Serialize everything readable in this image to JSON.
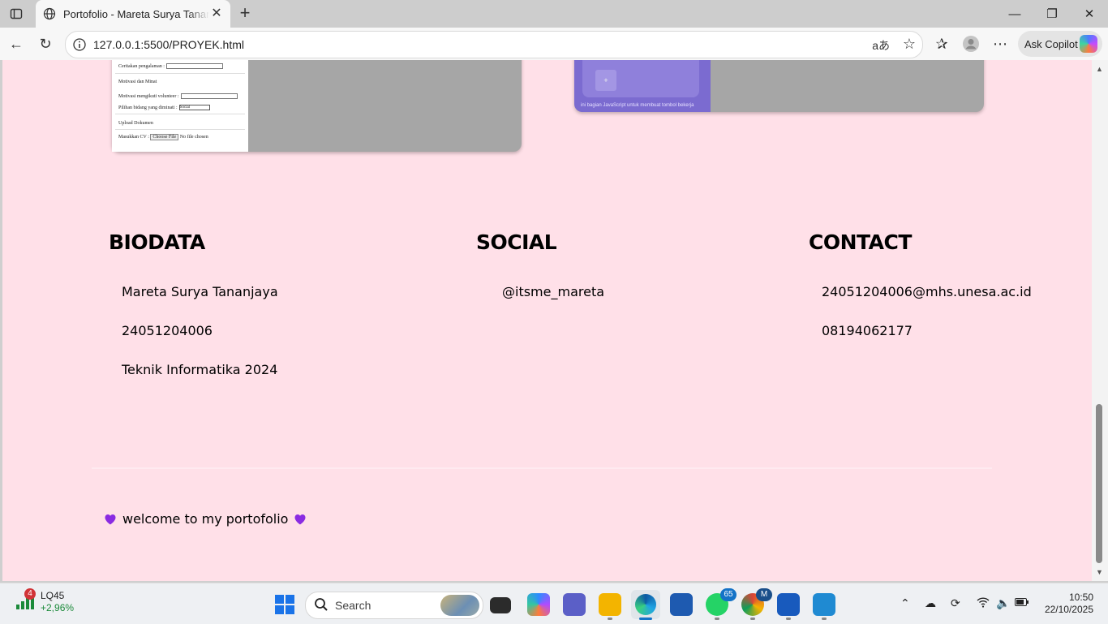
{
  "browser": {
    "tab_title": "Portofolio - Mareta Surya Tananja",
    "new_tab": "+",
    "url": "127.0.0.1:5500/PROYEK.html",
    "copilot_label": "Ask Copilot",
    "read_aloud_glyph": "aあ"
  },
  "page": {
    "project1_form": {
      "row1_label": "Ceritakan pengalaman :",
      "section_motivation": "Motivasi dan Minat",
      "row2_label": "Motivasi mengikuti volunteer :",
      "row3_label": "Pilihan bidang yang diminati :",
      "row3_value": "Social",
      "section_upload": "Upload Dokumen",
      "row4_label": "Masukkan CV :",
      "file_button": "Choose File",
      "file_status": "No file chosen"
    },
    "project2_caption": "ini bagian JavaScript untuk membuat tombol bekerja",
    "project2_plus": "+",
    "biodata": {
      "heading": "BIODATA",
      "name": "Mareta Surya Tananjaya",
      "nim": "24051204006",
      "program": "Teknik Informatika 2024"
    },
    "social": {
      "heading": "SOCIAL",
      "instagram": "@itsme_mareta"
    },
    "contact": {
      "heading": "CONTACT",
      "email": "24051204006@mhs.unesa.ac.id",
      "phone": "08194062177"
    },
    "footer_text": "welcome to my portofolio"
  },
  "taskbar": {
    "stock_badge": "4",
    "stock_name": "LQ45",
    "stock_change": "+2,96%",
    "search_label": "Search",
    "whatsapp_badge": "65",
    "chrome_badge": "M",
    "time": "10:50",
    "date": "22/10/2025"
  },
  "colors": {
    "page_bg": "#ffe0e8",
    "heart": "#8a2be2"
  }
}
